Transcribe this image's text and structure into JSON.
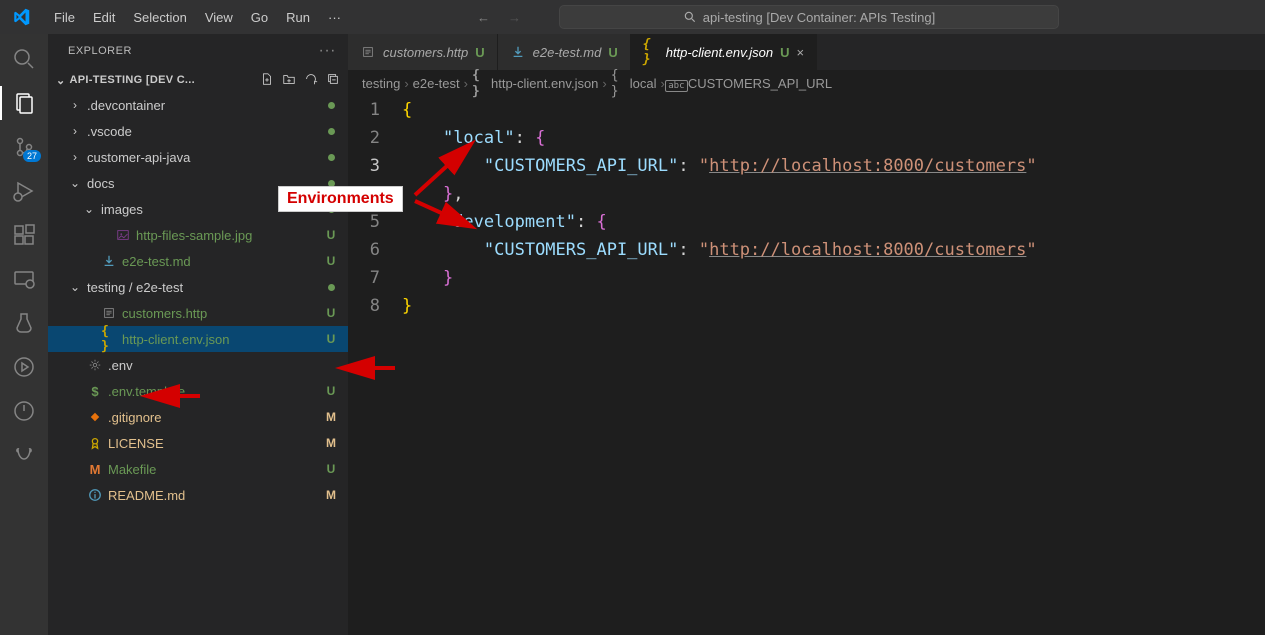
{
  "title_search": "api-testing [Dev Container: APIs Testing]",
  "menu": [
    "File",
    "Edit",
    "Selection",
    "View",
    "Go",
    "Run"
  ],
  "scm_badge": "27",
  "explorer_label": "EXPLORER",
  "workspace_name": "API-TESTING [DEV C...",
  "tree": [
    {
      "depth": 1,
      "twisty": "›",
      "icon": "",
      "name": ".devcontainer",
      "status": "dot"
    },
    {
      "depth": 1,
      "twisty": "›",
      "icon": "",
      "name": ".vscode",
      "status": "dot"
    },
    {
      "depth": 1,
      "twisty": "›",
      "icon": "",
      "name": "customer-api-java",
      "status": "dot"
    },
    {
      "depth": 1,
      "twisty": "⌄",
      "icon": "",
      "name": "docs",
      "status": "dot"
    },
    {
      "depth": 2,
      "twisty": "⌄",
      "icon": "",
      "name": "images",
      "status": "dot"
    },
    {
      "depth": 3,
      "twisty": "",
      "icon": "img",
      "iconClass": "icon-purple",
      "name": "http-files-sample.jpg",
      "status": "U"
    },
    {
      "depth": 2,
      "twisty": "",
      "icon": "dl",
      "iconClass": "icon-blue",
      "name": "e2e-test.md",
      "status": "U"
    },
    {
      "depth": 1,
      "twisty": "⌄",
      "icon": "",
      "name": "testing / e2e-test",
      "status": "dot"
    },
    {
      "depth": 2,
      "twisty": "",
      "icon": "tag",
      "iconClass": "icon-gray",
      "name": "customers.http",
      "status": "U"
    },
    {
      "depth": 2,
      "twisty": "",
      "icon": "braces",
      "iconClass": "icon-yellow",
      "name": "http-client.env.json",
      "status": "U",
      "selected": true
    },
    {
      "depth": 1,
      "twisty": "",
      "icon": "gear",
      "iconClass": "icon-gray",
      "name": ".env",
      "status": ""
    },
    {
      "depth": 1,
      "twisty": "",
      "icon": "dollar",
      "iconClass": "icon-green",
      "name": ".env.template",
      "status": "U"
    },
    {
      "depth": 1,
      "twisty": "",
      "icon": "diamond",
      "iconClass": "icon-orange",
      "name": ".gitignore",
      "status": "M"
    },
    {
      "depth": 1,
      "twisty": "",
      "icon": "ribbon",
      "iconClass": "icon-yellow",
      "name": "LICENSE",
      "status": "M"
    },
    {
      "depth": 1,
      "twisty": "",
      "icon": "M",
      "iconClass": "icon-m",
      "name": "Makefile",
      "status": "U"
    },
    {
      "depth": 1,
      "twisty": "",
      "icon": "info",
      "iconClass": "icon-blue",
      "name": "README.md",
      "status": "M"
    }
  ],
  "tabs": [
    {
      "icon": "tag",
      "iconClass": "icon-gray",
      "label": "customers.http",
      "mod": "U",
      "active": false
    },
    {
      "icon": "dl",
      "iconClass": "icon-blue",
      "label": "e2e-test.md",
      "mod": "U",
      "active": false
    },
    {
      "icon": "braces",
      "iconClass": "icon-yellow",
      "label": "http-client.env.json",
      "mod": "U",
      "active": true
    }
  ],
  "breadcrumb": [
    {
      "text": "testing"
    },
    {
      "text": "e2e-test"
    },
    {
      "icon": "braces",
      "text": "http-client.env.json"
    },
    {
      "icon": "braces-o",
      "text": "local"
    },
    {
      "icon": "abc",
      "text": "CUSTOMERS_API_URL"
    }
  ],
  "code_lines": [
    [
      {
        "t": "{",
        "c": "tk-brace"
      }
    ],
    [
      {
        "t": "    ",
        "c": ""
      },
      {
        "t": "\"local\"",
        "c": "tk-key"
      },
      {
        "t": ": ",
        "c": "tk-punc"
      },
      {
        "t": "{",
        "c": "tk-brace2"
      }
    ],
    [
      {
        "t": "        ",
        "c": ""
      },
      {
        "t": "\"CUSTOMERS_API_URL\"",
        "c": "tk-key"
      },
      {
        "t": ": ",
        "c": "tk-punc"
      },
      {
        "t": "\"",
        "c": "tk-str"
      },
      {
        "t": "http://localhost:8000/customers",
        "c": "tk-url"
      },
      {
        "t": "\"",
        "c": "tk-str"
      }
    ],
    [
      {
        "t": "    ",
        "c": ""
      },
      {
        "t": "}",
        "c": "tk-brace2"
      },
      {
        "t": ",",
        "c": "tk-punc"
      }
    ],
    [
      {
        "t": "    ",
        "c": ""
      },
      {
        "t": "\"development\"",
        "c": "tk-key"
      },
      {
        "t": ": ",
        "c": "tk-punc"
      },
      {
        "t": "{",
        "c": "tk-brace2"
      }
    ],
    [
      {
        "t": "        ",
        "c": ""
      },
      {
        "t": "\"CUSTOMERS_API_URL\"",
        "c": "tk-key"
      },
      {
        "t": ": ",
        "c": "tk-punc"
      },
      {
        "t": "\"",
        "c": "tk-str"
      },
      {
        "t": "http://localhost:8000/customers",
        "c": "tk-url"
      },
      {
        "t": "\"",
        "c": "tk-str"
      }
    ],
    [
      {
        "t": "    ",
        "c": ""
      },
      {
        "t": "}",
        "c": "tk-brace2"
      }
    ],
    [
      {
        "t": "}",
        "c": "tk-brace"
      }
    ]
  ],
  "annotation_label": "Environments"
}
